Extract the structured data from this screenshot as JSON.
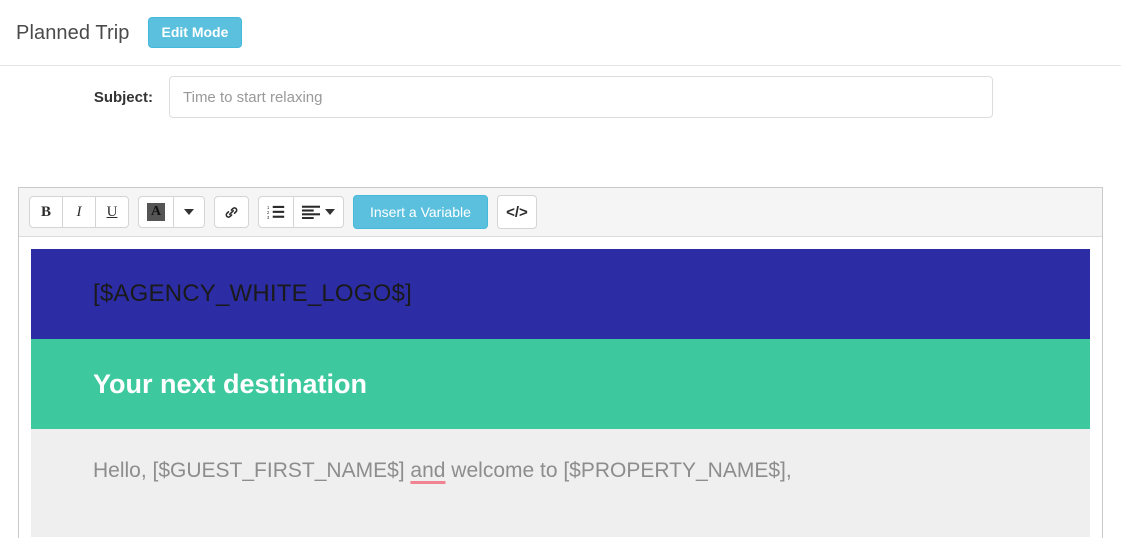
{
  "header": {
    "title": "Planned Trip",
    "edit_mode_label": "Edit Mode"
  },
  "subject": {
    "label": "Subject:",
    "value": "Time to start relaxing",
    "placeholder": "Time to start relaxing"
  },
  "toolbar": {
    "bold_label": "B",
    "italic_label": "I",
    "underline_label": "U",
    "font_color_label": "A",
    "insert_variable_label": "Insert a Variable",
    "code_label": "</>",
    "icons": {
      "font_color": "font-color-icon",
      "font_color_caret": "chevron-down-icon",
      "link": "link-icon",
      "ordered_list": "ordered-list-icon",
      "align": "align-left-icon",
      "align_caret": "chevron-down-icon",
      "code": "code-icon"
    }
  },
  "email": {
    "logo_token": "[$AGENCY_WHITE_LOGO$]",
    "hero_title": "Your next destination",
    "body_line_part1": "Hello, [$GUEST_FIRST_NAME$] ",
    "body_line_misspelled": "and",
    "body_line_part2": " welcome to [$PROPERTY_NAME$],"
  },
  "colors": {
    "logo_band": "#2c2ca5",
    "hero_band": "#3dc99d",
    "body_band": "#efefef",
    "accent_button": "#5bc0de",
    "spellcheck_underline": "#f08392"
  }
}
